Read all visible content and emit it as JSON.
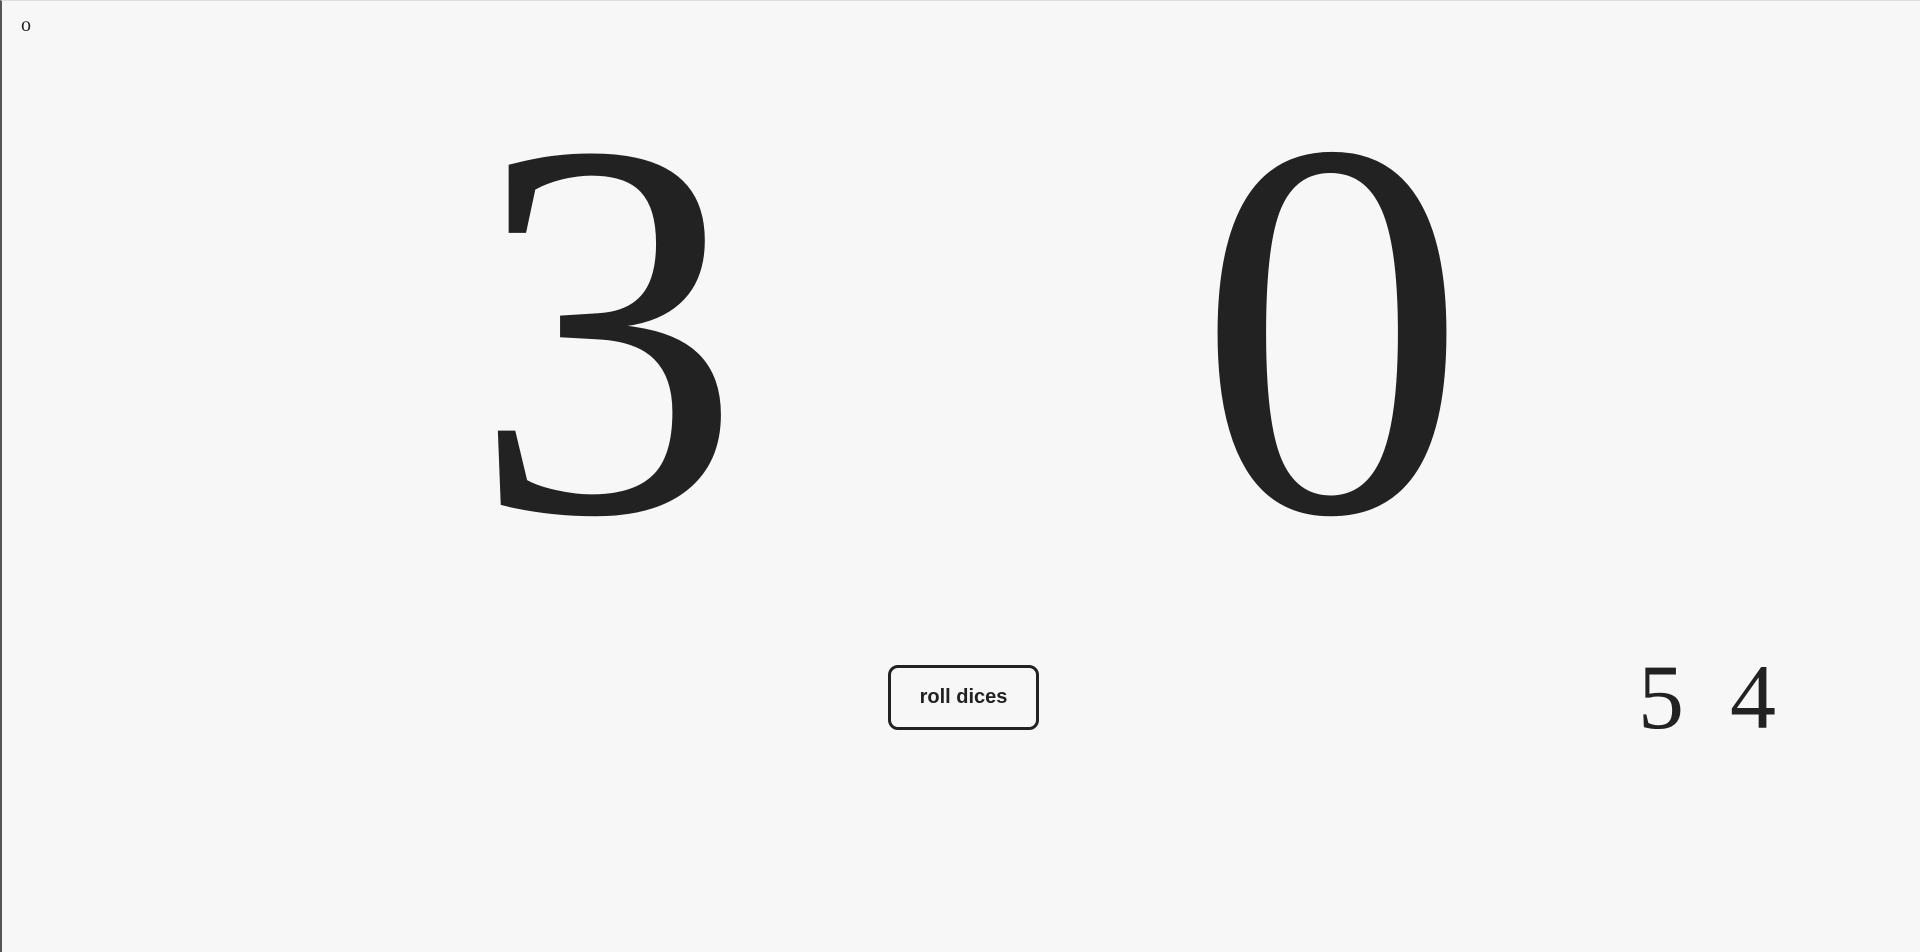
{
  "corner_mark": "o",
  "scores": {
    "left": "3",
    "right": "0"
  },
  "controls": {
    "roll_label": "roll dices"
  },
  "dice": {
    "first": "5",
    "second": "4"
  }
}
